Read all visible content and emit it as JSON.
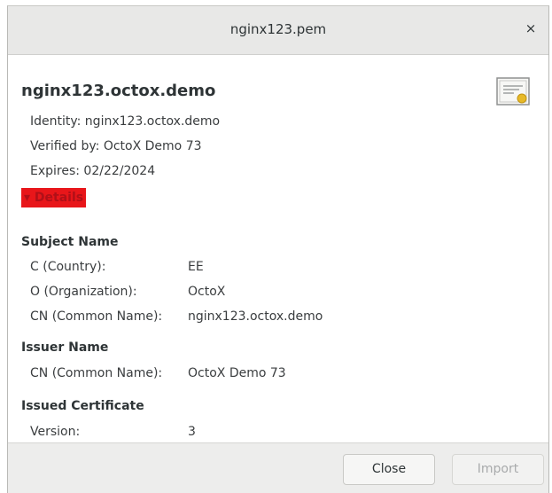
{
  "window": {
    "title": "nginx123.pem",
    "close_glyph": "×"
  },
  "certificate": {
    "name": "nginx123.octox.demo",
    "identity": "Identity: nginx123.octox.demo",
    "verified_by": "Verified by: OctoX Demo 73",
    "expires": "Expires: 02/22/2024",
    "icon": "certificate-icon"
  },
  "details": {
    "toggle_label": "▾ Details",
    "subject": {
      "heading": "Subject Name",
      "rows": [
        {
          "key": "C (Country):",
          "value": "EE"
        },
        {
          "key": "O (Organization):",
          "value": "OctoX"
        },
        {
          "key": "CN (Common Name):",
          "value": "nginx123.octox.demo"
        }
      ]
    },
    "issuer": {
      "heading": "Issuer Name",
      "rows": [
        {
          "key": "CN (Common Name):",
          "value": "OctoX Demo 73"
        }
      ]
    },
    "issued": {
      "heading": "Issued Certificate",
      "rows": [
        {
          "key": "Version:",
          "value": "3"
        }
      ]
    }
  },
  "footer": {
    "close_label": "Close",
    "import_label": "Import"
  },
  "colors": {
    "details_highlight": "#e8161a",
    "titlebar": "#e8e8e7"
  }
}
